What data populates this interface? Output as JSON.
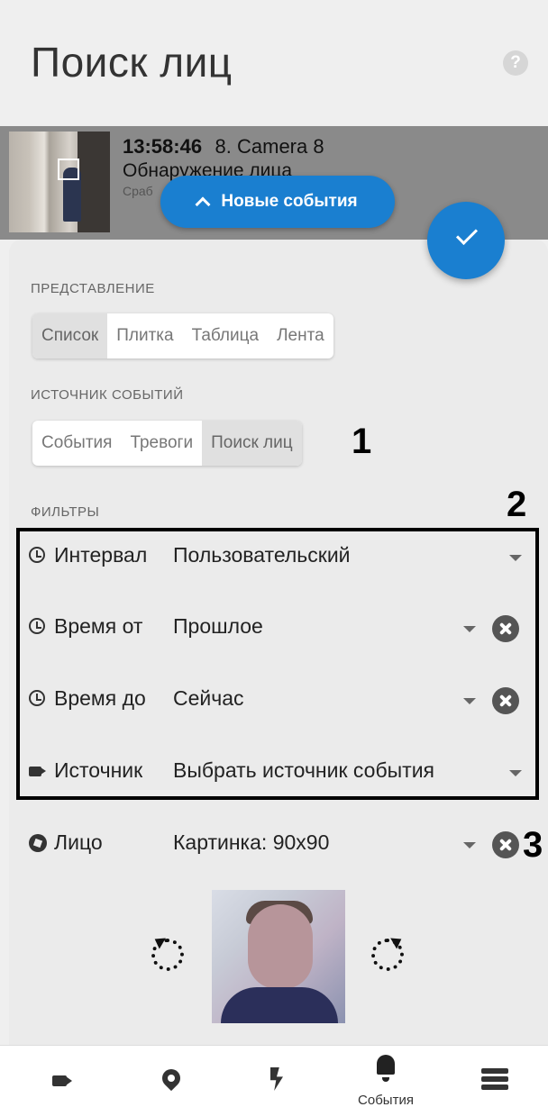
{
  "header": {
    "title": "Поиск лиц",
    "help_icon": "help-icon",
    "help_glyph": "?"
  },
  "event": {
    "time": "13:58:46",
    "camera": "8. Camera 8",
    "type": "Обнаружение лица",
    "trigger": "Сраб"
  },
  "new_events_button": {
    "label": "Новые события"
  },
  "view": {
    "section_label": "ПРЕДСТАВЛЕНИЕ",
    "options": [
      "Список",
      "Плитка",
      "Таблица",
      "Лента"
    ],
    "selected": "Список"
  },
  "source": {
    "section_label": "ИСТОЧНИК СОБЫТИЙ",
    "options": [
      "События",
      "Тревоги",
      "Поиск лиц"
    ],
    "selected": "Поиск лиц"
  },
  "filters": {
    "section_label": "ФИЛЬТРЫ",
    "rows": [
      {
        "label": "Интервал",
        "value": "Пользовательский",
        "icon": "clock-icon",
        "clearable": false
      },
      {
        "label": "Время от",
        "value": "Прошлое",
        "icon": "clock-icon",
        "clearable": true
      },
      {
        "label": "Время до",
        "value": "Сейчас",
        "icon": "clock-icon",
        "clearable": true
      },
      {
        "label": "Источник",
        "value": "Выбрать источник события",
        "icon": "camera-icon",
        "clearable": false
      }
    ]
  },
  "face": {
    "label": "Лицо",
    "value": "Картинка: 90x90",
    "icon": "aperture-icon"
  },
  "annotations": {
    "a1": "1",
    "a2": "2",
    "a3": "3"
  },
  "nav": {
    "items": [
      {
        "icon": "camera-icon",
        "label": ""
      },
      {
        "icon": "map-pin-icon",
        "label": ""
      },
      {
        "icon": "bolt-icon",
        "label": ""
      },
      {
        "icon": "bell-icon",
        "label": "События"
      },
      {
        "icon": "menu-icon",
        "label": ""
      }
    ]
  },
  "colors": {
    "accent": "#1a7fd0",
    "background": "#efefef"
  }
}
